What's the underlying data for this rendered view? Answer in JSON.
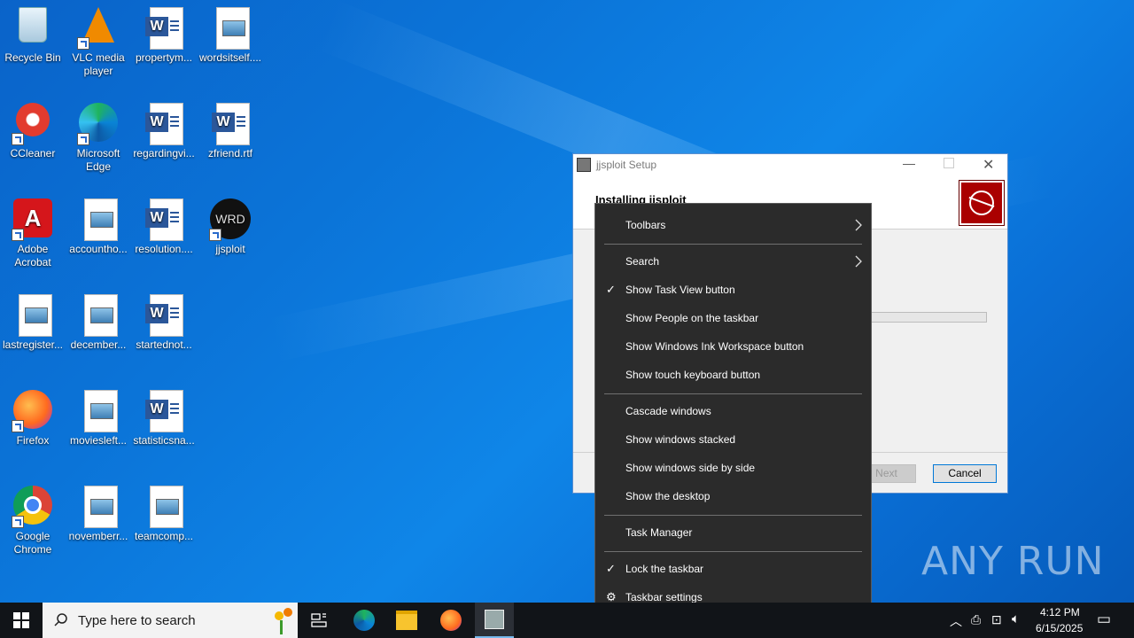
{
  "desktop": {
    "icons": [
      {
        "label": "Recycle Bin",
        "type": "recycle-bin"
      },
      {
        "label": "VLC media player",
        "type": "vlc"
      },
      {
        "label": "propertym...",
        "type": "word"
      },
      {
        "label": "wordsitself....",
        "type": "image"
      },
      {
        "label": "CCleaner",
        "type": "ccleaner"
      },
      {
        "label": "Microsoft Edge",
        "type": "edge"
      },
      {
        "label": "regardingvi...",
        "type": "word"
      },
      {
        "label": "zfriend.rtf",
        "type": "word"
      },
      {
        "label": "Adobe Acrobat",
        "type": "acrobat"
      },
      {
        "label": "accountho...",
        "type": "image"
      },
      {
        "label": "resolution....",
        "type": "word"
      },
      {
        "label": "jjsploit",
        "type": "jjsploit"
      },
      {
        "label": "lastregister...",
        "type": "image"
      },
      {
        "label": "december...",
        "type": "image"
      },
      {
        "label": "startednot...",
        "type": "word"
      },
      {
        "label": "Firefox",
        "type": "firefox"
      },
      {
        "label": "moviesleft...",
        "type": "image"
      },
      {
        "label": "statisticsna...",
        "type": "word"
      },
      {
        "label": "Google Chrome",
        "type": "chrome"
      },
      {
        "label": "novemberr...",
        "type": "image"
      },
      {
        "label": "teamcomp...",
        "type": "image"
      }
    ]
  },
  "installer": {
    "title": "jjsploit Setup",
    "heading": "Installing jjsploit",
    "progress": 0.17,
    "next_label": "Next",
    "cancel_label": "Cancel"
  },
  "context_menu": {
    "items": [
      {
        "label": "Toolbars",
        "submenu": true
      },
      {
        "label": "Search",
        "submenu": true
      },
      {
        "label": "Show Task View button",
        "checked": true
      },
      {
        "label": "Show People on the taskbar"
      },
      {
        "label": "Show Windows Ink Workspace button"
      },
      {
        "label": "Show touch keyboard button"
      },
      {
        "label": "Cascade windows"
      },
      {
        "label": "Show windows stacked"
      },
      {
        "label": "Show windows side by side"
      },
      {
        "label": "Show the desktop"
      },
      {
        "label": "Task Manager"
      },
      {
        "label": "Lock the taskbar",
        "checked": true
      },
      {
        "label": "Taskbar settings",
        "icon": "gear-icon"
      }
    ]
  },
  "taskbar": {
    "search_placeholder": "Type here to search",
    "time": "4:12 PM",
    "date": "6/15/2025"
  },
  "watermark": "ANY RUN"
}
